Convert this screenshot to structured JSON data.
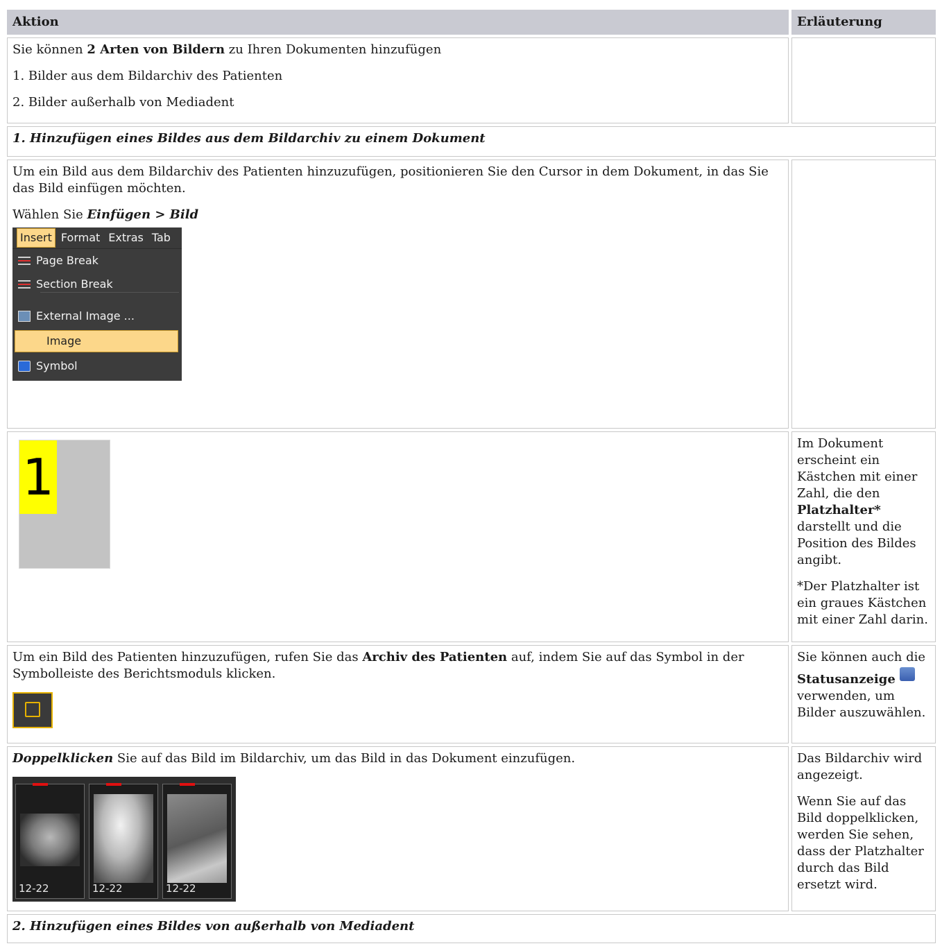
{
  "header": {
    "col_action": "Aktion",
    "col_explain": "Erläuterung"
  },
  "intro": {
    "prefix": "Sie können ",
    "bold": "2 Arten von Bildern",
    "suffix": " zu Ihren Dokumenten hinzufügen",
    "item1": "1. Bilder aus dem Bildarchiv des Patienten",
    "item2": "2. Bilder außerhalb von Mediadent"
  },
  "section1": {
    "title": "1. Hinzufügen eines Bildes aus dem Bildarchiv zu einem Dokument"
  },
  "step1": {
    "text": "Um ein Bild aus dem Bildarchiv des Patienten hinzuzufügen, positionieren Sie den Cursor in dem Dokument, in das Sie das Bild einfügen möchten.",
    "choose_prefix": "Wählen Sie ",
    "choose_bold": "Einfügen > Bild",
    "menu": {
      "bar": [
        "Insert",
        "Format",
        "Extras",
        "Tab"
      ],
      "items": [
        "Page Break",
        "Section Break",
        "External Image ...",
        "Image",
        "Symbol"
      ]
    }
  },
  "step2": {
    "placeholder_number": "1",
    "explain1_a": "Im Dokument erscheint ein Kästchen mit einer Zahl, die den ",
    "explain1_bold": "Platzhalter*",
    "explain1_b": " darstellt und die Position des Bildes angibt.",
    "explain2": "*Der Platzhalter ist ein graues Kästchen mit einer Zahl darin."
  },
  "step3": {
    "text_a": "Um ein Bild des Patienten hinzuzufügen, rufen Sie das ",
    "text_bold": "Archiv des Patienten",
    "text_b": " auf, indem Sie auf das Symbol in der Symbolleiste des Berichtsmoduls klicken.",
    "explain_a": "Sie können auch die",
    "explain_bold": "Statusanzeige",
    "explain_b": "verwenden, um Bilder auszuwählen."
  },
  "step4": {
    "text_bold": "Doppelklicken",
    "text_rest": " Sie auf das Bild im Bildarchiv, um das Bild in das Dokument einzufügen.",
    "thumb_labels": [
      "12-22",
      "12-22",
      "12-22"
    ],
    "explain1": "Das Bildarchiv wird angezeigt.",
    "explain2": "Wenn Sie auf das Bild doppelklicken, werden Sie sehen, dass der Platzhalter durch das Bild ersetzt wird."
  },
  "section2": {
    "title": "2. Hinzufügen eines Bildes von außerhalb von Mediadent"
  }
}
